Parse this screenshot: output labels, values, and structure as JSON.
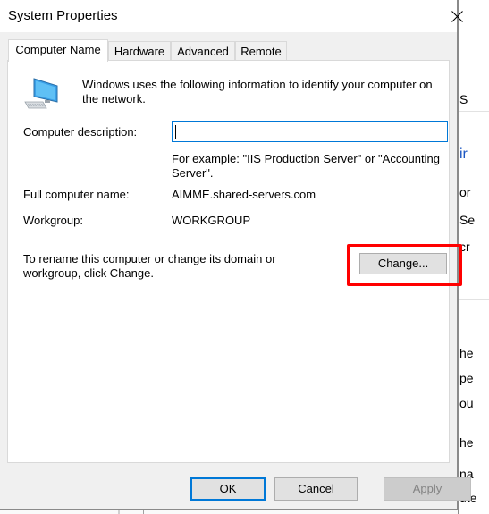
{
  "window": {
    "title": "System Properties",
    "close_icon": "close-x-icon"
  },
  "tabs": [
    {
      "label": "Computer Name",
      "active": true
    },
    {
      "label": "Hardware",
      "active": false
    },
    {
      "label": "Advanced",
      "active": false
    },
    {
      "label": "Remote",
      "active": false
    }
  ],
  "computer_name_tab": {
    "icon": "computer-monitor-icon",
    "intro": "Windows uses the following information to identify your computer on the network.",
    "description_label": "Computer description:",
    "description_value": "",
    "example_text": "For example: \"IIS Production Server\" or \"Accounting Server\".",
    "full_name_label": "Full computer name:",
    "full_name_value": "AIMME.shared-servers.com",
    "workgroup_label": "Workgroup:",
    "workgroup_value": "WORKGROUP",
    "rename_text": "To rename this computer or change its domain or workgroup, click Change.",
    "change_button": "Change...",
    "highlight_color": "#ff0000"
  },
  "footer": {
    "ok": "OK",
    "cancel": "Cancel",
    "apply": "Apply"
  },
  "background_fragments": [
    "S",
    "ir",
    "or",
    "Se",
    "cr",
    "he",
    "pe",
    "ou",
    "he",
    "na",
    "ute"
  ]
}
